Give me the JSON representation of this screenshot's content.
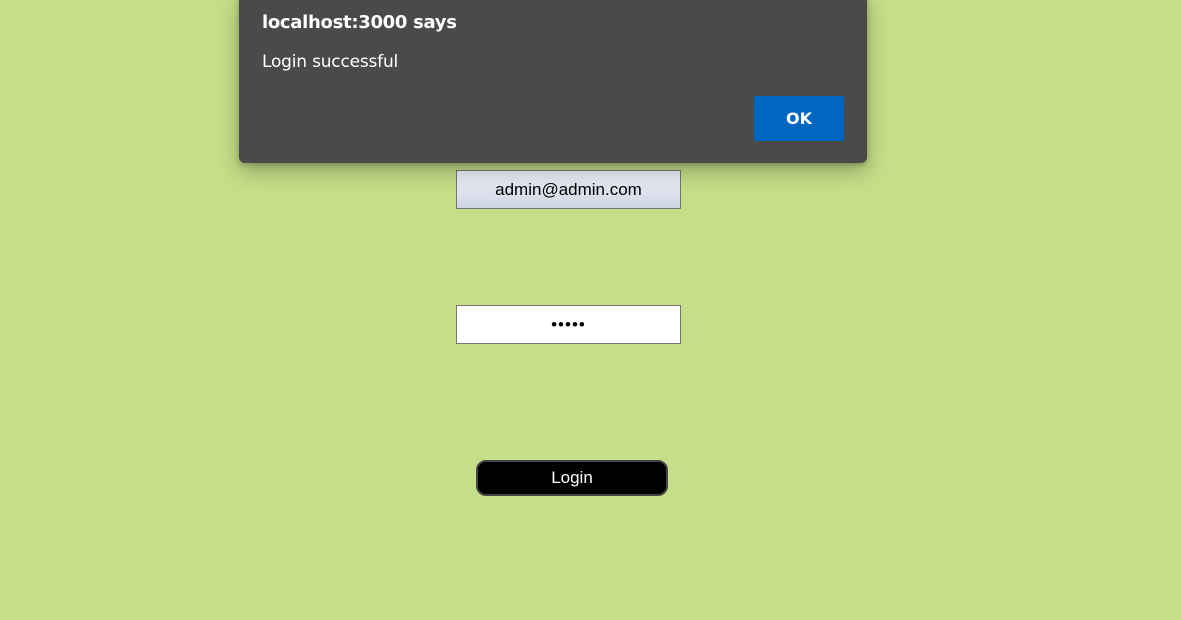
{
  "alert": {
    "title": "localhost:3000 says",
    "message": "Login successful",
    "ok_label": "OK"
  },
  "form": {
    "email_value": "admin@admin.com",
    "password_value": "admin",
    "login_label": "Login"
  },
  "colors": {
    "page_background": "#c4df88",
    "alert_background": "#4a4a4a",
    "ok_button": "#0067c0",
    "login_button": "#000000"
  }
}
